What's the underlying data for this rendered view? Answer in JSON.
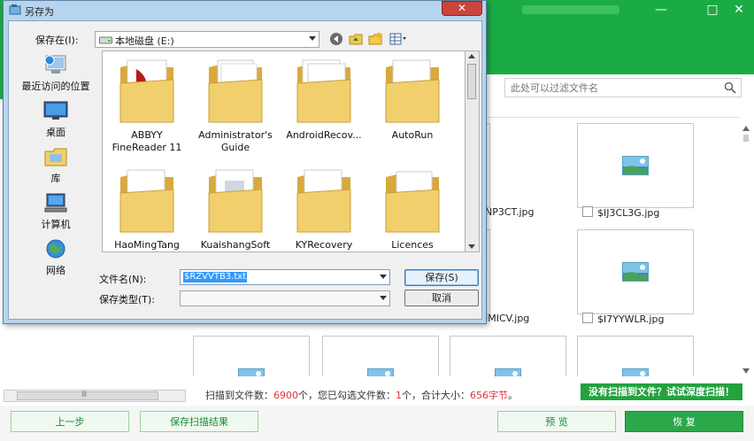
{
  "window_controls": [
    "—",
    "□",
    "✕"
  ],
  "filter": {
    "placeholder": "此处可以过滤文件名"
  },
  "thumbnails": [
    {
      "caption": "NP3CT.jpg",
      "checkbox": false
    },
    {
      "caption": "$IJ3CL3G.jpg",
      "checkbox": true
    },
    {
      "caption": "JMICV.jpg",
      "checkbox": false
    },
    {
      "caption": "$I7YYWLR.jpg",
      "checkbox": true
    },
    {
      "caption": "",
      "checkbox": false
    },
    {
      "caption": "",
      "checkbox": false
    },
    {
      "caption": "",
      "checkbox": false
    },
    {
      "caption": "",
      "checkbox": false
    }
  ],
  "status": {
    "prefix": "扫描到文件数：",
    "scanned": "6900",
    "mid1": "个，您已勾选文件数：",
    "selected": "1",
    "mid2": "个，合计大小：",
    "size": "656字节",
    "suffix": "。"
  },
  "deep_scan_label": "没有扫描到文件？试试深度扫描！",
  "bottom_buttons": {
    "prev": "上一步",
    "save_results": "保存扫描结果",
    "preview": "预 览",
    "recover": "恢 复"
  },
  "tree_scroll_glyph": "Ⅲ",
  "dialog": {
    "title": "另存为",
    "close": "✕",
    "save_in_label": "保存在(I):",
    "save_in_value": "本地磁盘 (E:)",
    "places": [
      "最近访问的位置",
      "桌面",
      "库",
      "计算机",
      "网络"
    ],
    "files": [
      "ABBYY FineReader 11",
      "Administrator's Guide",
      "AndroidRecov...",
      "AutoRun",
      "HaoMingTang",
      "KuaishangSoft",
      "KYRecovery",
      "Licences"
    ],
    "filename_label": "文件名(N):",
    "filename_value": "$RZVVTB3.txt",
    "filetype_label": "保存类型(T):",
    "filetype_value": "",
    "save_button": "保存(S)",
    "cancel_button": "取消"
  },
  "colors": {
    "brand": "#1bab44",
    "accent_red": "#e2343a",
    "dialog_frame": "#b7d4ee"
  }
}
